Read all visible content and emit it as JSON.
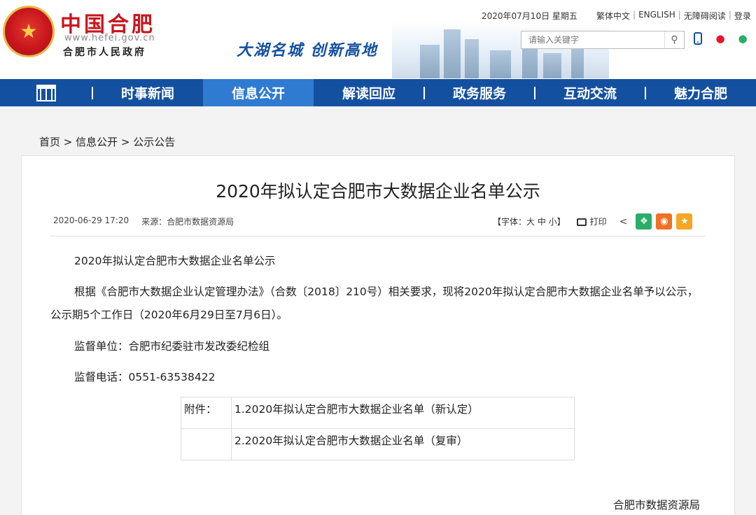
{
  "header": {
    "site_title": "中国合肥",
    "site_url": "www.hefei.gov.cn",
    "site_subtitle": "合肥市人民政府",
    "slogan": "大湖名城  创新高地",
    "date": "2020年07月10日 星期五",
    "links": [
      "繁体中文",
      "ENGLISH",
      "无障碍阅读",
      "登录"
    ],
    "search_placeholder": "请输入关键字"
  },
  "nav": {
    "items": [
      "时事新闻",
      "信息公开",
      "解读回应",
      "政务服务",
      "互动交流",
      "魅力合肥"
    ],
    "active": "信息公开"
  },
  "breadcrumb": "首页 > 信息公开 > 公示公告",
  "article": {
    "title": "2020年拟认定合肥市大数据企业名单公示",
    "date": "2020-06-29 17:20",
    "source": "来源：合肥市数据资源局",
    "font_size_label": "【字体：大  中  小】",
    "print_label": "打印",
    "paragraphs": [
      "2020年拟认定合肥市大数据企业名单公示",
      "根据《合肥市大数据企业认定管理办法》（合数〔2018〕210号）相关要求，现将2020年拟认定合肥市大数据企业名单予以公示，公示期5个工作日（2020年6月29日至7月6日）。",
      "监督单位：合肥市纪委驻市发改委纪检组",
      "监督电话：0551-63538422"
    ],
    "attachments_label": "附件：",
    "attachments": [
      "1.2020年拟认定合肥市大数据企业名单（新认定）",
      "2.2020年拟认定合肥市大数据企业名单（复审）"
    ],
    "signature": "合肥市数据资源局"
  },
  "colors": {
    "nav_bg": "#1450a0",
    "nav_active": "#2f7bd2",
    "brand_red": "#c8161d"
  }
}
